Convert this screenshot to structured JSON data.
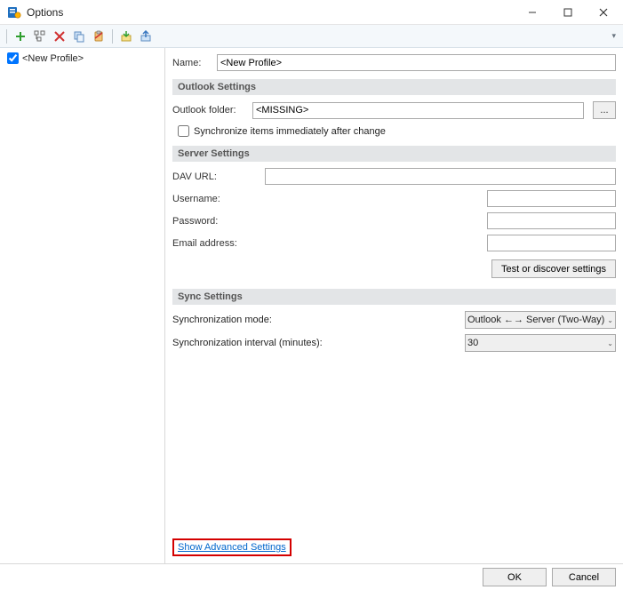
{
  "window": {
    "title": "Options"
  },
  "toolbar": {
    "icons": [
      "add",
      "tree",
      "delete",
      "copy",
      "clipboard",
      "import",
      "export"
    ]
  },
  "profiles": {
    "items": [
      {
        "label": "<New Profile>",
        "checked": true
      }
    ]
  },
  "form": {
    "name_label": "Name:",
    "name_value": "<New Profile>",
    "outlook_section": "Outlook Settings",
    "outlook_folder_label": "Outlook folder:",
    "outlook_folder_value": "<MISSING>",
    "browse_label": "...",
    "sync_immediate_label": "Synchronize items immediately after change",
    "sync_immediate_checked": false,
    "server_section": "Server Settings",
    "dav_url_label": "DAV URL:",
    "dav_url_value": "",
    "username_label": "Username:",
    "username_value": "",
    "password_label": "Password:",
    "password_value": "",
    "email_label": "Email address:",
    "email_value": "",
    "test_button": "Test or discover settings",
    "sync_section": "Sync Settings",
    "sync_mode_label": "Synchronization mode:",
    "sync_mode_value": "Outlook ←→ Server (Two-Way)",
    "sync_interval_label": "Synchronization interval (minutes):",
    "sync_interval_value": "30",
    "advanced_link": "Show Advanced Settings"
  },
  "footer": {
    "ok": "OK",
    "cancel": "Cancel"
  }
}
